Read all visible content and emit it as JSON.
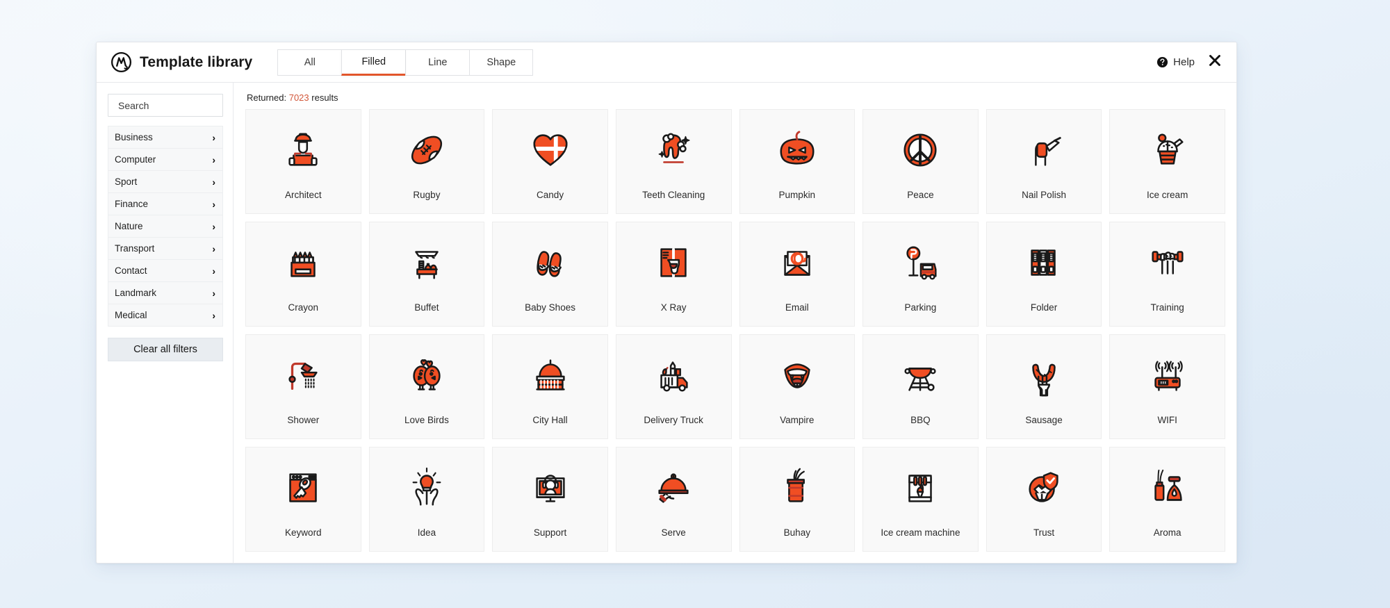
{
  "header": {
    "brand_title": "Template library",
    "logo_icon": "brand-monogram-icon",
    "tabs": [
      {
        "label": "All",
        "active": false
      },
      {
        "label": "Filled",
        "active": true
      },
      {
        "label": "Line",
        "active": false
      },
      {
        "label": "Shape",
        "active": false
      }
    ],
    "help_label": "Help",
    "help_icon": "question-circle-icon",
    "close_icon": "close-icon"
  },
  "sidebar": {
    "search_placeholder": "Search",
    "search_value": "",
    "categories": [
      {
        "label": "Business"
      },
      {
        "label": "Computer"
      },
      {
        "label": "Sport"
      },
      {
        "label": "Finance"
      },
      {
        "label": "Nature"
      },
      {
        "label": "Transport"
      },
      {
        "label": "Contact"
      },
      {
        "label": "Landmark"
      },
      {
        "label": "Medical"
      }
    ],
    "chevron_glyph": "›",
    "clear_label": "Clear all filters"
  },
  "main": {
    "returned_prefix": "Returned:",
    "returned_count": "7023",
    "returned_suffix": "results",
    "results": [
      {
        "label": "Architect",
        "icon": "architect-icon"
      },
      {
        "label": "Rugby",
        "icon": "rugby-ball-icon"
      },
      {
        "label": "Candy",
        "icon": "candy-heart-icon"
      },
      {
        "label": "Teeth Cleaning",
        "icon": "teeth-cleaning-icon"
      },
      {
        "label": "Pumpkin",
        "icon": "pumpkin-icon"
      },
      {
        "label": "Peace",
        "icon": "peace-sign-icon"
      },
      {
        "label": "Nail Polish",
        "icon": "nail-polish-icon"
      },
      {
        "label": "Ice cream",
        "icon": "ice-cream-sundae-icon"
      },
      {
        "label": "Crayon",
        "icon": "crayon-box-icon"
      },
      {
        "label": "Buffet",
        "icon": "buffet-table-icon"
      },
      {
        "label": "Baby Shoes",
        "icon": "baby-shoes-icon"
      },
      {
        "label": "X Ray",
        "icon": "x-ray-icon"
      },
      {
        "label": "Email",
        "icon": "email-envelope-icon"
      },
      {
        "label": "Parking",
        "icon": "parking-sign-car-icon"
      },
      {
        "label": "Folder",
        "icon": "folder-binders-icon"
      },
      {
        "label": "Training",
        "icon": "dumbbell-hand-icon"
      },
      {
        "label": "Shower",
        "icon": "shower-icon"
      },
      {
        "label": "Love Birds",
        "icon": "love-birds-icon"
      },
      {
        "label": "City Hall",
        "icon": "city-hall-icon"
      },
      {
        "label": "Delivery Truck",
        "icon": "delivery-truck-icon"
      },
      {
        "label": "Vampire",
        "icon": "vampire-mouth-icon"
      },
      {
        "label": "BBQ",
        "icon": "bbq-grill-icon"
      },
      {
        "label": "Sausage",
        "icon": "sausage-fork-icon"
      },
      {
        "label": "WIFI",
        "icon": "wifi-router-icon"
      },
      {
        "label": "Keyword",
        "icon": "keyword-browser-key-icon"
      },
      {
        "label": "Idea",
        "icon": "idea-bulb-hands-icon"
      },
      {
        "label": "Support",
        "icon": "support-headset-monitor-icon"
      },
      {
        "label": "Serve",
        "icon": "serve-cloche-icon"
      },
      {
        "label": "Buhay",
        "icon": "buhay-can-icon"
      },
      {
        "label": "Ice cream machine",
        "icon": "ice-cream-machine-icon"
      },
      {
        "label": "Trust",
        "icon": "trust-handshake-shield-icon"
      },
      {
        "label": "Aroma",
        "icon": "aroma-diffuser-icon"
      }
    ]
  },
  "colors": {
    "accent": "#f04e23",
    "accent_dark": "#c0392b",
    "tab_underline": "#e2562b",
    "count_text": "#d2573a",
    "card_bg": "#f9f9f9",
    "page_bg": "#eaf2fa"
  }
}
